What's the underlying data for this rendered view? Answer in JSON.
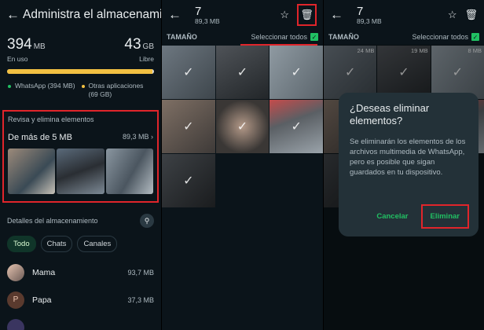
{
  "panel1": {
    "title": "Administra el almacenamiento",
    "used_value": "394",
    "used_unit": "MB",
    "used_label": "En uso",
    "free_value": "43",
    "free_unit": "GB",
    "free_label": "Libre",
    "usage_fraction": 0.99,
    "legend": [
      {
        "label": "WhatsApp (394 MB)",
        "color": "#21c063"
      },
      {
        "label": "Otras aplicaciones (69 GB)",
        "color": "#f2c042"
      }
    ],
    "review": {
      "title": "Revisa y elimina elementos",
      "row_label": "De más de 5 MB",
      "row_size": "89,3 MB"
    },
    "details_label": "Detalles del almacenamiento",
    "chips": [
      "Todo",
      "Chats",
      "Canales"
    ],
    "contacts": [
      {
        "name": "Mama",
        "size": "93,7 MB",
        "initial": ""
      },
      {
        "name": "Papa",
        "size": "37,3 MB",
        "initial": "P"
      }
    ]
  },
  "selection": {
    "count": "7",
    "size": "89,3 MB",
    "sort_label": "TAMAÑO",
    "select_all": "Seleccionar todos"
  },
  "grid_sizes": [
    "24 MB",
    "19 MB",
    "8 MB"
  ],
  "dialog": {
    "title": "¿Deseas eliminar elementos?",
    "body": "Se eliminarán los elementos de los archivos multimedia de WhatsApp, pero es posible que sigan guardados en tu dispositivo.",
    "cancel": "Cancelar",
    "confirm": "Eliminar"
  },
  "colors": {
    "background": "#0b141a",
    "accent": "#21c063",
    "highlight": "#e0252b",
    "other_apps": "#f2c042"
  }
}
